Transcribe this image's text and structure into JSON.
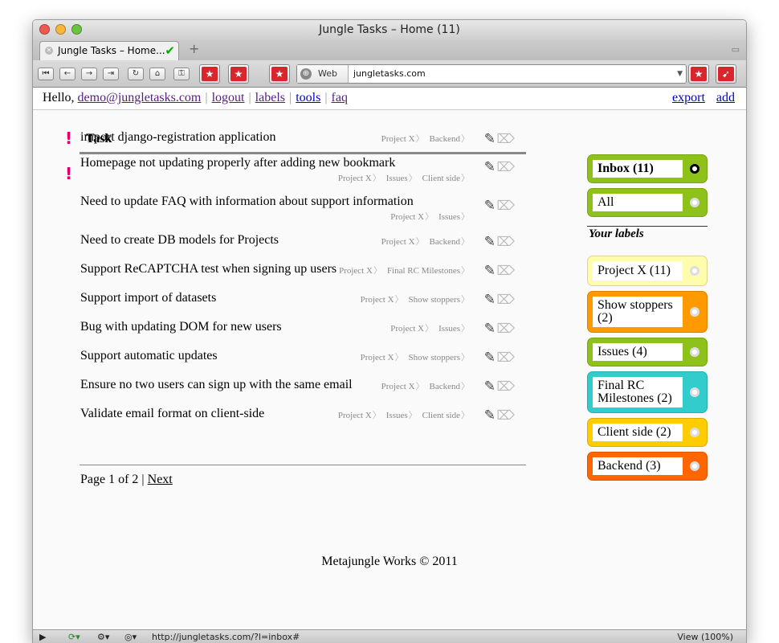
{
  "browser": {
    "window_title": "Jungle Tasks – Home (11)",
    "tab_title": "Jungle Tasks – Home...",
    "url_mode": "Web",
    "url": "jungletasks.com",
    "status_url": "http://jungletasks.com/?l=inbox#",
    "zoom_label": "View (100%)"
  },
  "nav": {
    "hello": "Hello,",
    "user": "demo@jungletasks.com",
    "logout": "logout",
    "labels": "labels",
    "tools": "tools",
    "faq": "faq",
    "export": "export",
    "add": "add"
  },
  "tasks_header": "Task",
  "tasks": [
    {
      "title": "import django-registration application",
      "priority": "!",
      "tags": [
        "Project X",
        "Backend"
      ]
    },
    {
      "title": "Homepage not updating properly after adding new bookmark",
      "priority": "!",
      "tags": [
        "Project X",
        "Issues",
        "Client side"
      ]
    },
    {
      "title": "Need to update FAQ with information about support information",
      "priority": "",
      "tags": [
        "Project X",
        "Issues"
      ]
    },
    {
      "title": "Need to create DB models for Projects",
      "priority": "",
      "tags": [
        "Project X",
        "Backend"
      ]
    },
    {
      "title": "Support ReCAPTCHA test when signing up users",
      "priority": "",
      "tags": [
        "Project X",
        "Final RC Milestones"
      ]
    },
    {
      "title": "Support import of datasets",
      "priority": "",
      "tags": [
        "Project X",
        "Show stoppers"
      ]
    },
    {
      "title": "Bug with updating DOM for new users",
      "priority": "",
      "tags": [
        "Project X",
        "Issues"
      ]
    },
    {
      "title": "Support automatic updates",
      "priority": "",
      "tags": [
        "Project X",
        "Show stoppers"
      ]
    },
    {
      "title": "Ensure no two users can sign up with the same email",
      "priority": "",
      "tags": [
        "Project X",
        "Backend"
      ]
    },
    {
      "title": "Validate email format on client-side",
      "priority": "",
      "tags": [
        "Project X",
        "Issues",
        "Client side"
      ]
    }
  ],
  "pager": {
    "text": "Page 1 of 2 |",
    "next": "Next"
  },
  "footer": "Metajungle Works © 2011",
  "sidebar": {
    "your_labels": "Your labels",
    "top": [
      {
        "label": "Inbox (11)",
        "color": "#8ec21a",
        "active": true
      },
      {
        "label": "All",
        "color": "#8ec21a",
        "active": false
      }
    ],
    "labels": [
      {
        "label": "Project X (11)",
        "color": "#fffcae"
      },
      {
        "label": "Show stoppers (2)",
        "color": "#ff9900"
      },
      {
        "label": "Issues (4)",
        "color": "#8ec21a"
      },
      {
        "label": "Final RC Milestones (2)",
        "color": "#33cccc"
      },
      {
        "label": "Client side (2)",
        "color": "#ffcc00"
      },
      {
        "label": "Backend (3)",
        "color": "#ff6600"
      }
    ]
  }
}
